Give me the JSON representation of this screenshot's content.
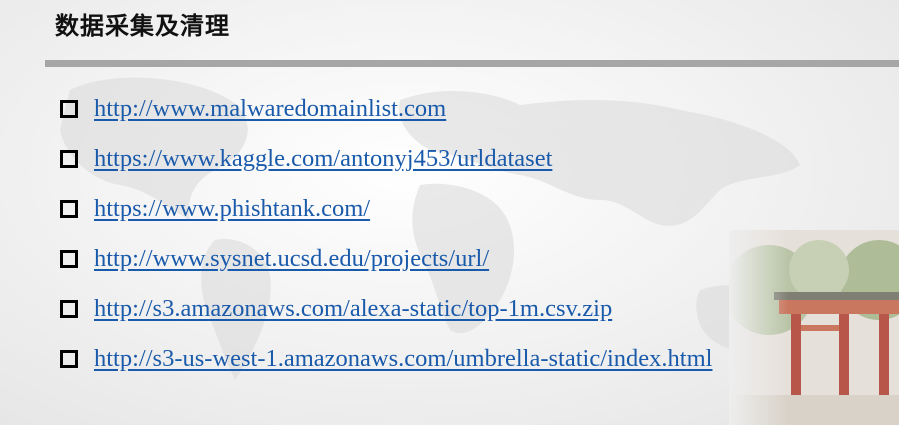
{
  "slide": {
    "title": "数据采集及清理"
  },
  "links": [
    {
      "text": "http://www.malwaredomainlist.com"
    },
    {
      "text": "https://www.kaggle.com/antonyj453/urldataset"
    },
    {
      "text": "https://www.phishtank.com/"
    },
    {
      "text": "http://www.sysnet.ucsd.edu/projects/url/"
    },
    {
      "text": "http://s3.amazonaws.com/alexa-static/top-1m.csv.zip"
    },
    {
      "text": "http://s3-us-west-1.amazonaws.com/umbrella-static/index.html"
    }
  ],
  "colors": {
    "link": "#1a5aab",
    "rule": "#a6a6a6",
    "title": "#111111"
  },
  "icons": {
    "bullet": "hollow-square-bullet-icon",
    "background": "world-map-icon",
    "photo": "campus-gate-photo"
  }
}
